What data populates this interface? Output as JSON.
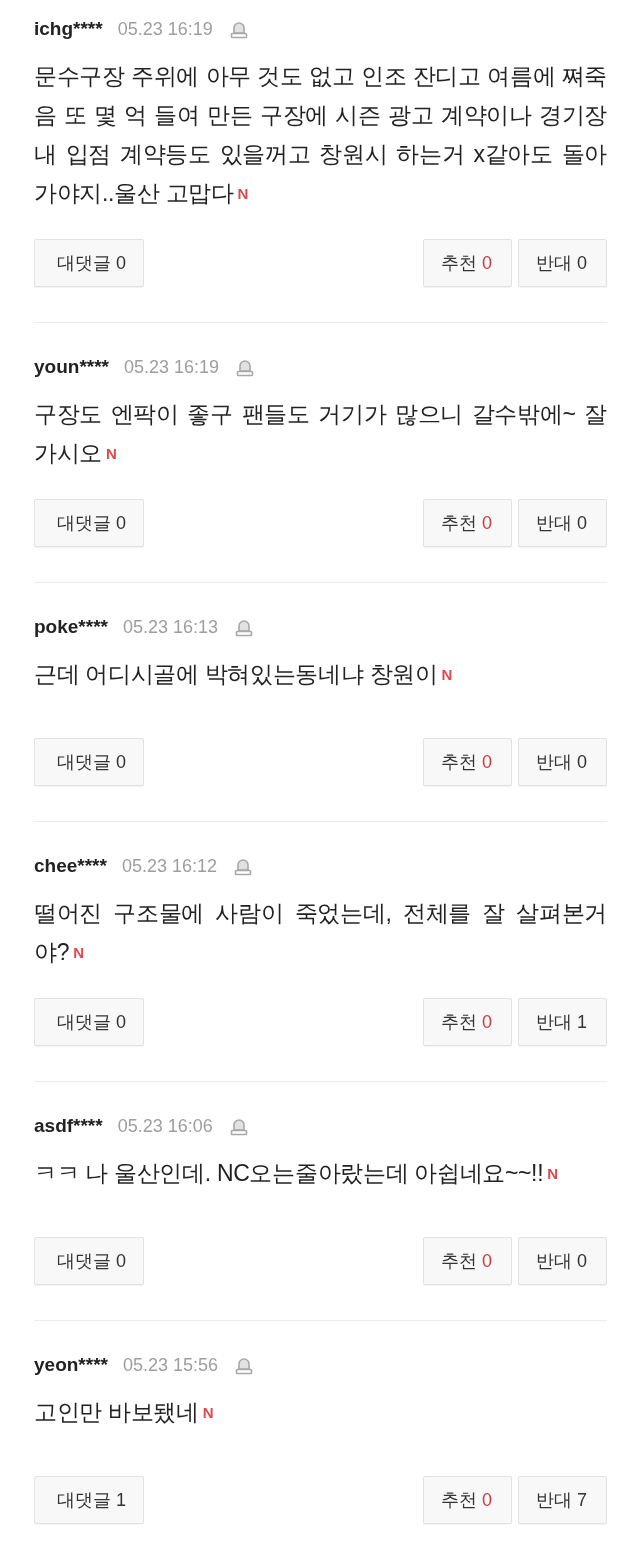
{
  "comments": [
    {
      "author": "ichg****",
      "time": "05.23 16:19",
      "text": "문수구장 주위에 아무 것도 없고 인조 잔디고 여름에 쪄죽음 또 몇 억 들여 만든 구장에 시즌 광고 계약이나 경기장 내 입점 계약등도 있을꺼고 창원시 하는거 x같아도 돌아가야지..울산 고맙다",
      "new_badge": "N",
      "actions": [
        {
          "kind": "reply",
          "label": "대댓글",
          "count": "0"
        },
        {
          "kind": "like",
          "label": "추천",
          "count": "0"
        },
        {
          "kind": "dislike",
          "label": "반대",
          "count": "0"
        }
      ]
    },
    {
      "author": "youn****",
      "time": "05.23 16:19",
      "text": "구장도 엔팍이 좋구 팬들도 거기가 많으니 갈수밖에~ 잘가시오",
      "new_badge": "N",
      "actions": [
        {
          "kind": "reply",
          "label": "대댓글",
          "count": "0"
        },
        {
          "kind": "like",
          "label": "추천",
          "count": "0"
        },
        {
          "kind": "dislike",
          "label": "반대",
          "count": "0"
        }
      ]
    },
    {
      "author": "poke****",
      "time": "05.23 16:13",
      "text": "근데 어디시골에 박혀있는동네냐 창원이",
      "new_badge": "N",
      "actions": [
        {
          "kind": "reply",
          "label": "대댓글",
          "count": "0"
        },
        {
          "kind": "like",
          "label": "추천",
          "count": "0"
        },
        {
          "kind": "dislike",
          "label": "반대",
          "count": "0"
        }
      ]
    },
    {
      "author": "chee****",
      "time": "05.23 16:12",
      "text": "떨어진 구조물에 사람이 죽었는데, 전체를 잘 살펴본거야?",
      "new_badge": "N",
      "actions": [
        {
          "kind": "reply",
          "label": "대댓글",
          "count": "0"
        },
        {
          "kind": "like",
          "label": "추천",
          "count": "0"
        },
        {
          "kind": "dislike",
          "label": "반대",
          "count": "1"
        }
      ]
    },
    {
      "author": "asdf****",
      "time": "05.23 16:06",
      "text": "ㅋㅋ 나 울산인데. NC오는줄아랐는데 아쉽네요~~!!",
      "new_badge": "N",
      "actions": [
        {
          "kind": "reply",
          "label": "대댓글",
          "count": "0"
        },
        {
          "kind": "like",
          "label": "추천",
          "count": "0"
        },
        {
          "kind": "dislike",
          "label": "반대",
          "count": "0"
        }
      ]
    },
    {
      "author": "yeon****",
      "time": "05.23 15:56",
      "text": "고인만 바보됐네",
      "new_badge": "N",
      "actions": [
        {
          "kind": "reply",
          "label": "대댓글",
          "count": "1"
        },
        {
          "kind": "like",
          "label": "추천",
          "count": "0"
        },
        {
          "kind": "dislike",
          "label": "반대",
          "count": "7"
        }
      ]
    }
  ]
}
